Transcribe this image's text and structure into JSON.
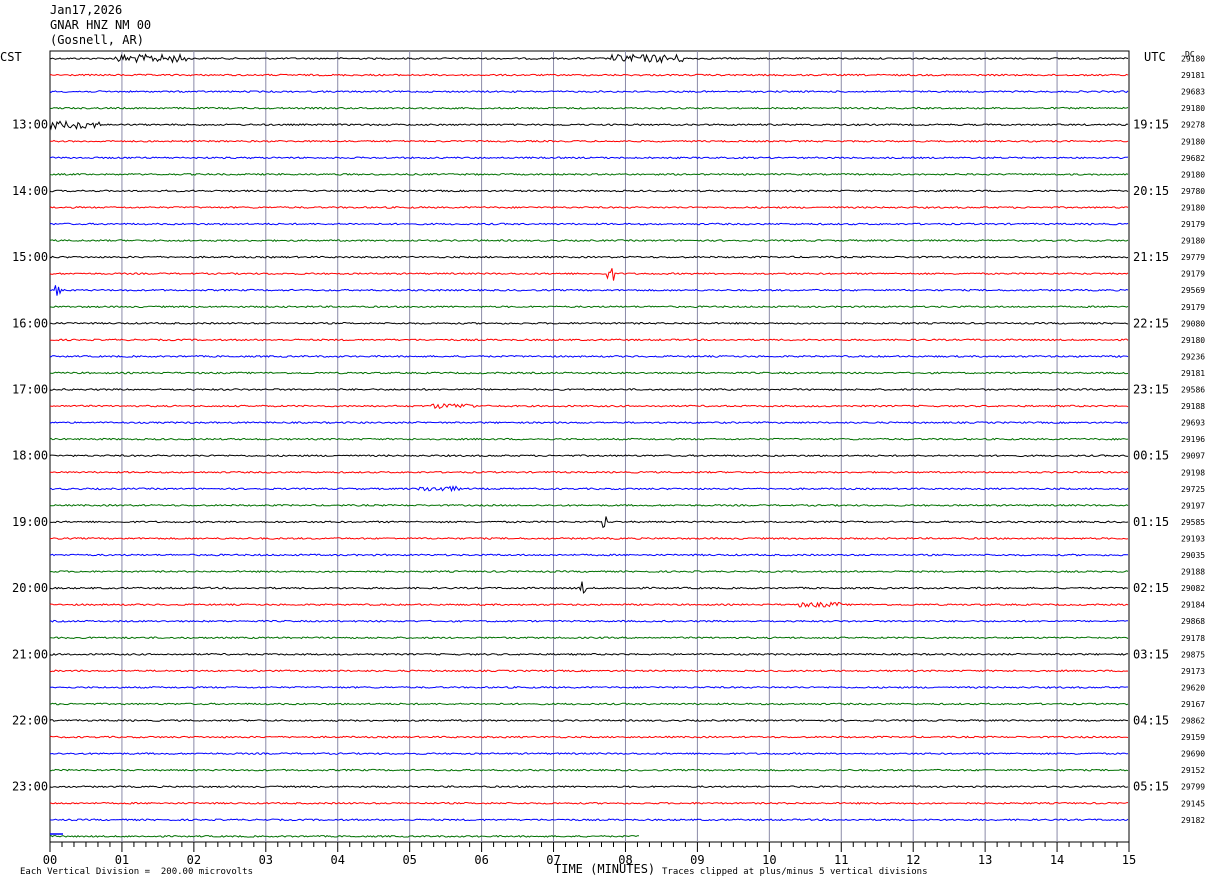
{
  "header": {
    "date": "Jan17,2026",
    "station": "GNAR HNZ NM 00",
    "location": "(Gosnell, AR)"
  },
  "left_timezone": "CST",
  "right_timezone": "UTC",
  "dc_label": "DC",
  "footer": {
    "scale_note": "Each Vertical Division =  200.00 microvolts",
    "xaxis_title": "TIME (MINUTES)",
    "clip_note": "Traces clipped at plus/minus 5 vertical divisions"
  },
  "chart_data": {
    "type": "line",
    "title": "",
    "xlabel": "TIME (MINUTES)",
    "xlim": [
      0,
      15
    ],
    "x_ticks": [
      "00",
      "01",
      "02",
      "03",
      "04",
      "05",
      "06",
      "07",
      "08",
      "09",
      "10",
      "11",
      "12",
      "13",
      "14",
      "15"
    ],
    "trace_colors": [
      "#000000",
      "#ff0000",
      "#0000ff",
      "#007000"
    ],
    "left_hour_labels": [
      "13:00",
      "14:00",
      "15:00",
      "16:00",
      "17:00",
      "18:00",
      "19:00",
      "20:00",
      "21:00",
      "22:00",
      "23:00"
    ],
    "right_hour_labels": [
      "19:15",
      "20:15",
      "21:15",
      "22:15",
      "23:15",
      "00:15",
      "01:15",
      "02:15",
      "03:15",
      "04:15",
      "05:15"
    ],
    "dc_values": [
      "29180",
      "29181",
      "29683",
      "29180",
      "29278",
      "29180",
      "29682",
      "29180",
      "29780",
      "29180",
      "29179",
      "29180",
      "29779",
      "29179",
      "29569",
      "29179",
      "29080",
      "29180",
      "29236",
      "29181",
      "29586",
      "29188",
      "29693",
      "29196",
      "29097",
      "29198",
      "29725",
      "29197",
      "29585",
      "29193",
      "29035",
      "29188",
      "29082",
      "29184",
      "29868",
      "29178",
      "29875",
      "29173",
      "29620",
      "29167",
      "29862",
      "29159",
      "29690",
      "29152",
      "29799",
      "29145",
      "29182"
    ],
    "trace_count": 48,
    "last_trace_end_minute": 8.2,
    "events": [
      {
        "trace": 0,
        "minute": 1.4,
        "amplitude": "high"
      },
      {
        "trace": 0,
        "minute": 8.3,
        "amplitude": "high"
      },
      {
        "trace": 4,
        "minute": 0.2,
        "amplitude": "high"
      },
      {
        "trace": 13,
        "minute": 7.8,
        "amplitude": "spike"
      },
      {
        "trace": 14,
        "minute": 0.1,
        "amplitude": "spike"
      },
      {
        "trace": 21,
        "minute": 5.6,
        "amplitude": "medium"
      },
      {
        "trace": 26,
        "minute": 5.4,
        "amplitude": "medium"
      },
      {
        "trace": 28,
        "minute": 7.7,
        "amplitude": "spike"
      },
      {
        "trace": 32,
        "minute": 7.4,
        "amplitude": "spike"
      },
      {
        "trace": 33,
        "minute": 10.7,
        "amplitude": "medium"
      }
    ]
  }
}
